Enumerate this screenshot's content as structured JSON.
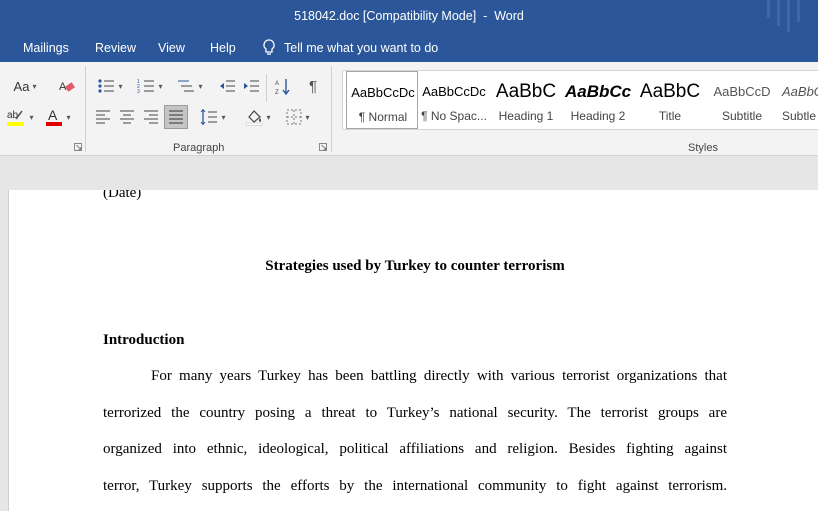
{
  "window": {
    "title": "518042.doc [Compatibility Mode]  -  Word"
  },
  "menu": {
    "tabs": [
      "Mailings",
      "Review",
      "View",
      "Help"
    ],
    "tell_me": "Tell me what you want to do"
  },
  "ribbon": {
    "font_group": {
      "change_case": "Aa"
    },
    "paragraph_label": "Paragraph",
    "styles_label": "Styles",
    "styles": [
      {
        "sample": "AaBbCcDc",
        "name": "¶ Normal"
      },
      {
        "sample": "AaBbCcDc",
        "name": "¶ No Spac..."
      },
      {
        "sample": "AaBbC",
        "name": "Heading 1"
      },
      {
        "sample": "AaBbCc",
        "name": "Heading 2"
      },
      {
        "sample": "AaBbC",
        "name": "Title"
      },
      {
        "sample": "AaBbCcD",
        "name": "Subtitle"
      },
      {
        "sample": "AaBbCcD",
        "name": "Subtle Em..."
      }
    ]
  },
  "document": {
    "date": "(Date)",
    "title": "Strategies used by Turkey to counter terrorism",
    "section_heading": "Introduction",
    "lines": [
      "For many years Turkey has been battling directly with various terrorist organizations that",
      "terrorized the country posing a threat to Turkey’s national security. The terrorist groups are",
      "organized into ethnic, ideological, political affiliations and religion. Besides fighting against",
      "terror, Turkey supports the efforts by the international community to fight against terrorism."
    ]
  },
  "colors": {
    "title_bar": "#2b579a",
    "ribbon": "#f3f3f3",
    "page": "#ffffff"
  }
}
